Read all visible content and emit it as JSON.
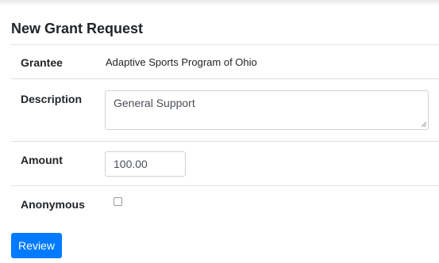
{
  "form": {
    "title": "New Grant Request",
    "grantee": {
      "label": "Grantee",
      "value": "Adaptive Sports Program of Ohio"
    },
    "description": {
      "label": "Description",
      "value": "General Support"
    },
    "amount": {
      "label": "Amount",
      "value": "100.00"
    },
    "anonymous": {
      "label": "Anonymous",
      "checked": false
    },
    "review_button": "Review"
  },
  "colors": {
    "primary": "#007bff",
    "border": "#ced4da",
    "divider": "#dee2e6"
  }
}
